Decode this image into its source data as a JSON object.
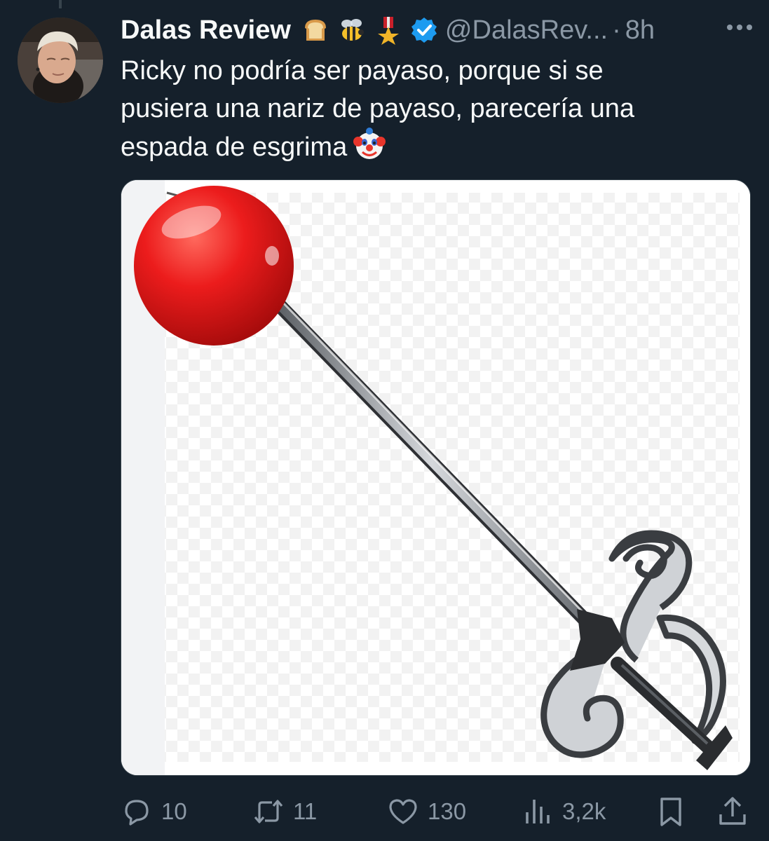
{
  "tweet": {
    "author_name": "Dalas Review",
    "header_emojis": [
      "bread-icon",
      "bee-icon",
      "military-medal-icon"
    ],
    "verified_icon": "verified-badge-icon",
    "handle": "@DalasRev...",
    "separator": "·",
    "time": "8h",
    "more_icon": "more-dots-icon",
    "text_line_1": "Ricky no podría ser payaso, porque si se",
    "text_line_2": "pusiera una nariz de payaso, parecería una",
    "text_line_3": "espada de esgrima",
    "text_trailing_emoji": "clown-face-icon",
    "media_description_icon": "red-nose-fencing-sword-image"
  },
  "actions": {
    "reply": {
      "icon": "reply-icon",
      "count": "10"
    },
    "retweet": {
      "icon": "retweet-icon",
      "count": "11"
    },
    "like": {
      "icon": "heart-icon",
      "count": "130"
    },
    "views": {
      "icon": "views-chart-icon",
      "count": "3,2k"
    },
    "bookmark": {
      "icon": "bookmark-icon"
    },
    "share": {
      "icon": "share-icon"
    }
  },
  "colors": {
    "background": "#15202b",
    "text": "#f7f9f9",
    "muted": "#8b98a5",
    "verified": "#1d9bf0",
    "nose_red": "#e8131b"
  }
}
